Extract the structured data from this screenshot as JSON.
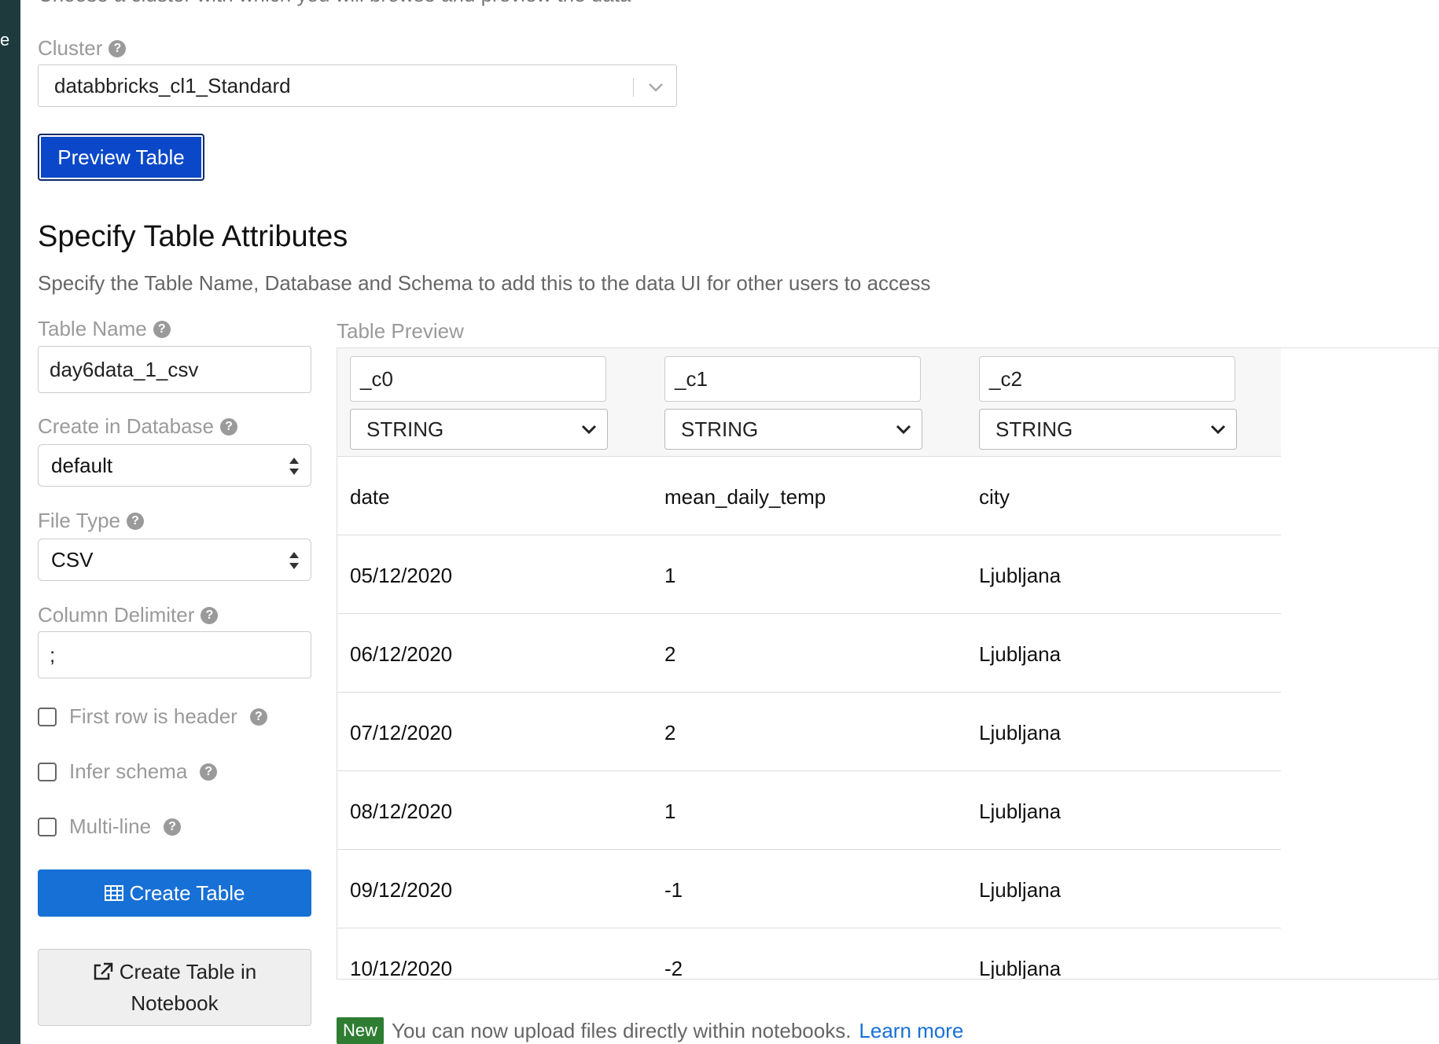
{
  "sidebar": {
    "edge_char": "e"
  },
  "top_cut_text": "Choose a cluster with which you will browse and preview the data",
  "cluster": {
    "label": "Cluster",
    "value": "databbricks_cl1_Standard"
  },
  "preview_button": "Preview Table",
  "section": {
    "title": "Specify Table Attributes",
    "description": "Specify the Table Name, Database and Schema to add this to the data UI for other users to access"
  },
  "form": {
    "table_name_label": "Table Name",
    "table_name_value": "day6data_1_csv",
    "database_label": "Create in Database",
    "database_value": "default",
    "file_type_label": "File Type",
    "file_type_value": "CSV",
    "delimiter_label": "Column Delimiter",
    "delimiter_value": ";",
    "first_row_header_label": "First row is header",
    "infer_schema_label": "Infer schema",
    "multiline_label": "Multi-line",
    "create_table_label": "Create Table",
    "create_notebook_label_line1": "Create Table in",
    "create_notebook_label_line2": "Notebook"
  },
  "preview": {
    "label": "Table Preview",
    "columns": [
      {
        "name": "_c0",
        "type": "STRING"
      },
      {
        "name": "_c1",
        "type": "STRING"
      },
      {
        "name": "_c2",
        "type": "STRING"
      }
    ],
    "rows": [
      [
        "date",
        "mean_daily_temp",
        "city"
      ],
      [
        "05/12/2020",
        "1",
        "Ljubljana"
      ],
      [
        "06/12/2020",
        "2",
        "Ljubljana"
      ],
      [
        "07/12/2020",
        "2",
        "Ljubljana"
      ],
      [
        "08/12/2020",
        "1",
        "Ljubljana"
      ],
      [
        "09/12/2020",
        "-1",
        "Ljubljana"
      ],
      [
        "10/12/2020",
        "-2",
        "Ljubljana"
      ]
    ]
  },
  "notice": {
    "badge": "New",
    "text": "You can now upload files directly within notebooks.",
    "link": "Learn more"
  }
}
